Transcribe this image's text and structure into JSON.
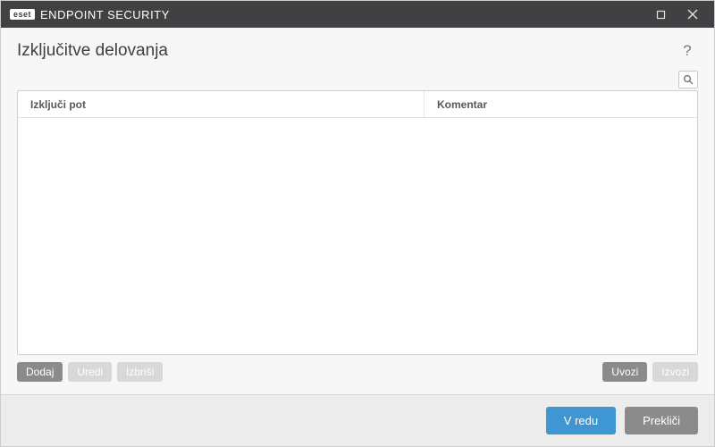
{
  "titlebar": {
    "brand_badge": "eset",
    "brand_text": "ENDPOINT SECURITY"
  },
  "heading": "Izključitve delovanja",
  "help_label": "?",
  "table": {
    "col_path": "Izključi pot",
    "col_comment": "Komentar"
  },
  "actions": {
    "add": "Dodaj",
    "edit": "Uredi",
    "delete": "Izbriši",
    "import": "Uvozi",
    "export": "Izvozi"
  },
  "footer": {
    "ok": "V redu",
    "cancel": "Prekliči"
  }
}
